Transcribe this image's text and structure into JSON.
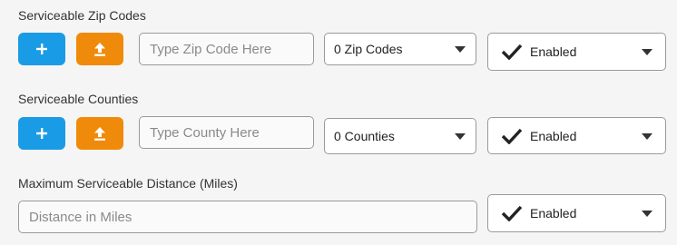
{
  "zip_section": {
    "label": "Serviceable Zip Codes",
    "add_icon": "plus-icon",
    "upload_icon": "upload-icon",
    "input_placeholder": "Type Zip Code Here",
    "count_select": "0 Zip Codes",
    "status": "Enabled"
  },
  "county_section": {
    "label": "Serviceable Counties",
    "add_icon": "plus-icon",
    "upload_icon": "upload-icon",
    "input_placeholder": "Type County Here",
    "count_select": "0 Counties",
    "status": "Enabled"
  },
  "distance_section": {
    "label": "Maximum Serviceable Distance (Miles)",
    "input_placeholder": "Distance in Miles",
    "status": "Enabled"
  },
  "colors": {
    "add_button": "#1a9be6",
    "upload_button": "#f08a0a",
    "background": "#f5f5f5"
  }
}
